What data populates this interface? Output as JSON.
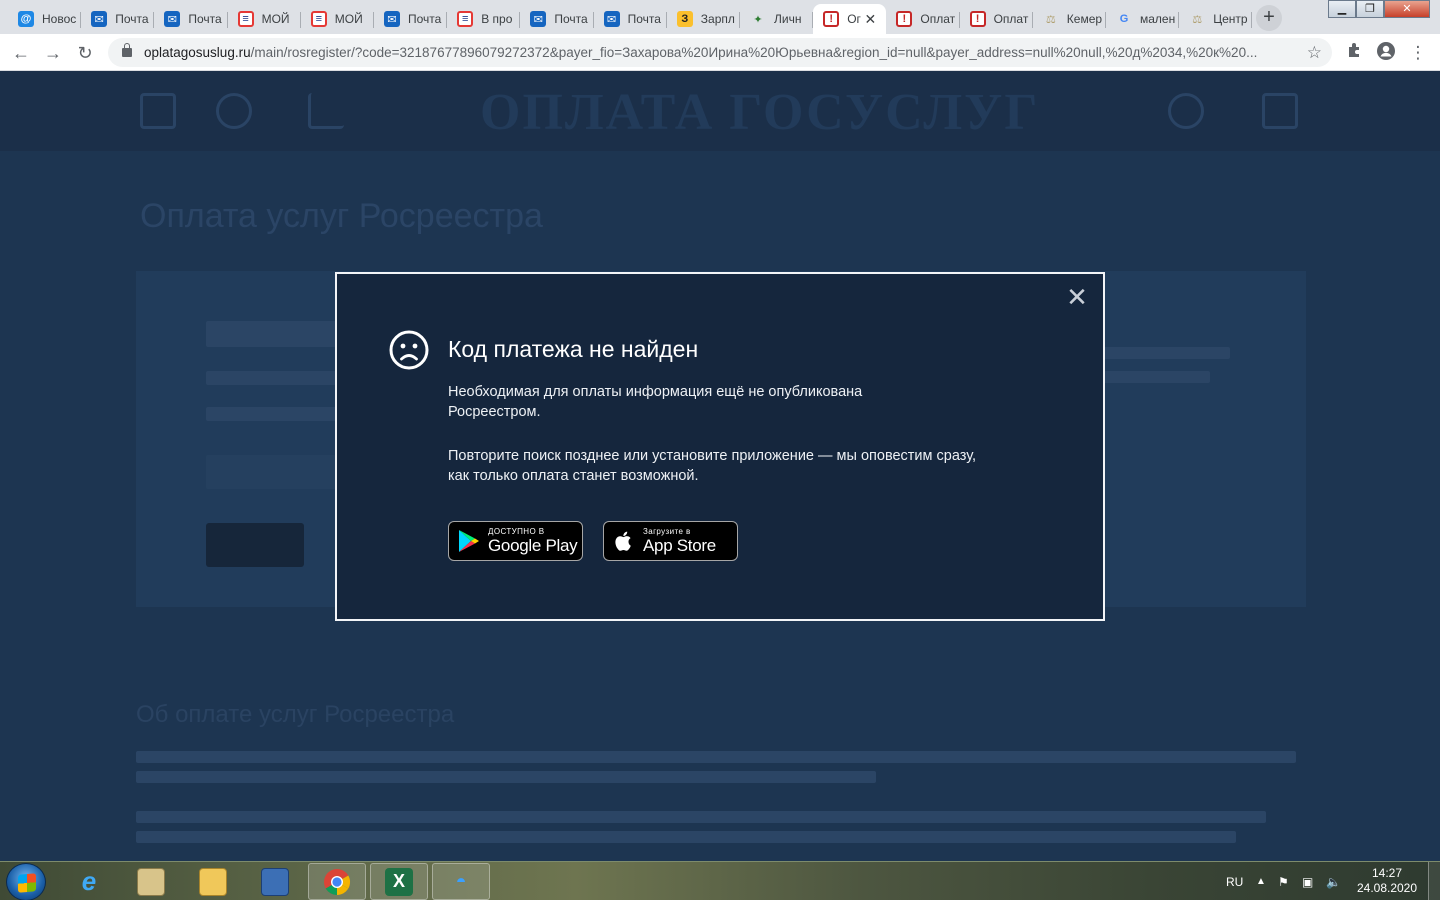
{
  "browser": {
    "tabs": [
      {
        "title": "Новос",
        "icon": "at-mail-icon"
      },
      {
        "title": "Почта",
        "icon": "mail-icon"
      },
      {
        "title": "Почта",
        "icon": "mail-icon"
      },
      {
        "title": "МОЙ",
        "icon": "moi-icon"
      },
      {
        "title": "МОЙ",
        "icon": "moi-icon"
      },
      {
        "title": "Почта",
        "icon": "mail-icon"
      },
      {
        "title": "В про",
        "icon": "moi-icon"
      },
      {
        "title": "Почта",
        "icon": "mail-icon"
      },
      {
        "title": "Почта",
        "icon": "mail-icon"
      },
      {
        "title": "Зарпл",
        "icon": "zarplata-icon"
      },
      {
        "title": "Личн",
        "icon": "leaf-icon"
      },
      {
        "title": "Ог",
        "icon": "stop-icon",
        "active": true
      },
      {
        "title": "Оплат",
        "icon": "stop-icon"
      },
      {
        "title": "Оплат",
        "icon": "stop-icon"
      },
      {
        "title": "Кемер",
        "icon": "scales-icon"
      },
      {
        "title": "мален",
        "icon": "google-icon"
      },
      {
        "title": "Центр",
        "icon": "scales-icon"
      }
    ],
    "url_host": "oplatagosuslug.ru",
    "url_path": "/main/rosregister/?code=32187677896079272372&payer_fio=Захарова%20Ирина%20Юрьевна&region_id=null&payer_address=null%20null,%20д%2034,%20к%20..."
  },
  "page": {
    "logo": "ОПЛАТА ГОСУСЛУГ",
    "title": "Оплата услуг Росреестра",
    "section_title": "Об оплате услуг Росреестра"
  },
  "modal": {
    "title": "Код платежа не найден",
    "text1": "Необходимая для оплаты информация ещё не опубликована Росреестром.",
    "text2": "Повторите поиск позднее или установите приложение — мы оповестим сразу, как только оплата станет возможной.",
    "google_small": "ДОСТУПНО В",
    "google_big": "Google Play",
    "apple_small": "Загрузите в",
    "apple_big": "App Store"
  },
  "taskbar": {
    "lang": "RU",
    "time": "14:27",
    "date": "24.08.2020"
  },
  "colors": {
    "overlay_bg": "#1c3450",
    "modal_bg": "#15263d",
    "modal_border": "#f2f4f7",
    "tabstrip": "#dee1e6"
  }
}
